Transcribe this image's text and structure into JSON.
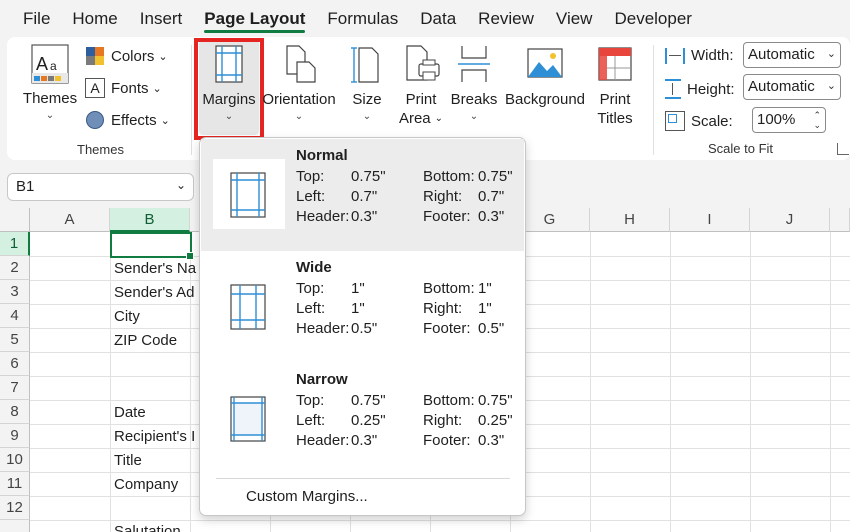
{
  "tabs": [
    {
      "label": "File"
    },
    {
      "label": "Home"
    },
    {
      "label": "Insert"
    },
    {
      "label": "Page Layout",
      "active": true
    },
    {
      "label": "Formulas"
    },
    {
      "label": "Data"
    },
    {
      "label": "Review"
    },
    {
      "label": "View"
    },
    {
      "label": "Developer"
    }
  ],
  "ribbon": {
    "themes": {
      "themes_label": "Themes",
      "colors_label": "Colors",
      "fonts_label": "Fonts",
      "effects_label": "Effects",
      "group_label": "Themes"
    },
    "page_setup": {
      "margins_label": "Margins",
      "orientation_label": "Orientation",
      "size_label": "Size",
      "print_area_line1": "Print",
      "print_area_line2": "Area",
      "breaks_label": "Breaks",
      "background_label": "Background",
      "print_titles_line1": "Print",
      "print_titles_line2": "Titles"
    },
    "scale_to_fit": {
      "width_label": "Width:",
      "width_value": "Automatic",
      "height_label": "Height:",
      "height_value": "Automatic",
      "scale_label": "Scale:",
      "scale_value": "100%",
      "group_label": "Scale to Fit"
    }
  },
  "name_box": {
    "value": "B1"
  },
  "columns": [
    "A",
    "B",
    "C",
    "D",
    "E",
    "F",
    "G",
    "H",
    "I",
    "J"
  ],
  "rows": [
    "1",
    "2",
    "3",
    "4",
    "5",
    "6",
    "7",
    "8",
    "9",
    "10",
    "11",
    "12"
  ],
  "cells": {
    "b2": "Sender's Na",
    "b3": "Sender's Ad",
    "b4": "City",
    "b5": "ZIP Code",
    "b8": "Date",
    "b9": "Recipient's I",
    "b10": "Title",
    "b11": "Company",
    "b13": "Salutation"
  },
  "margins_menu": {
    "options": [
      {
        "name": "Normal",
        "top_label": "Top:",
        "top": "0.75\"",
        "bottom_label": "Bottom:",
        "bottom": "0.75\"",
        "left_label": "Left:",
        "left": "0.7\"",
        "right_label": "Right:",
        "right": "0.7\"",
        "header_label": "Header:",
        "header": "0.3\"",
        "footer_label": "Footer:",
        "footer": "0.3\""
      },
      {
        "name": "Wide",
        "top_label": "Top:",
        "top": "1\"",
        "bottom_label": "Bottom:",
        "bottom": "1\"",
        "left_label": "Left:",
        "left": "1\"",
        "right_label": "Right:",
        "right": "1\"",
        "header_label": "Header:",
        "header": "0.5\"",
        "footer_label": "Footer:",
        "footer": "0.5\""
      },
      {
        "name": "Narrow",
        "top_label": "Top:",
        "top": "0.75\"",
        "bottom_label": "Bottom:",
        "bottom": "0.75\"",
        "left_label": "Left:",
        "left": "0.25\"",
        "right_label": "Right:",
        "right": "0.25\"",
        "header_label": "Header:",
        "header": "0.3\"",
        "footer_label": "Footer:",
        "footer": "0.3\""
      }
    ],
    "custom_label": "Custom Margins..."
  },
  "colors": {
    "accent": "#107c41",
    "highlight": "#e52521",
    "icon_blue": "#2e8fd6"
  }
}
